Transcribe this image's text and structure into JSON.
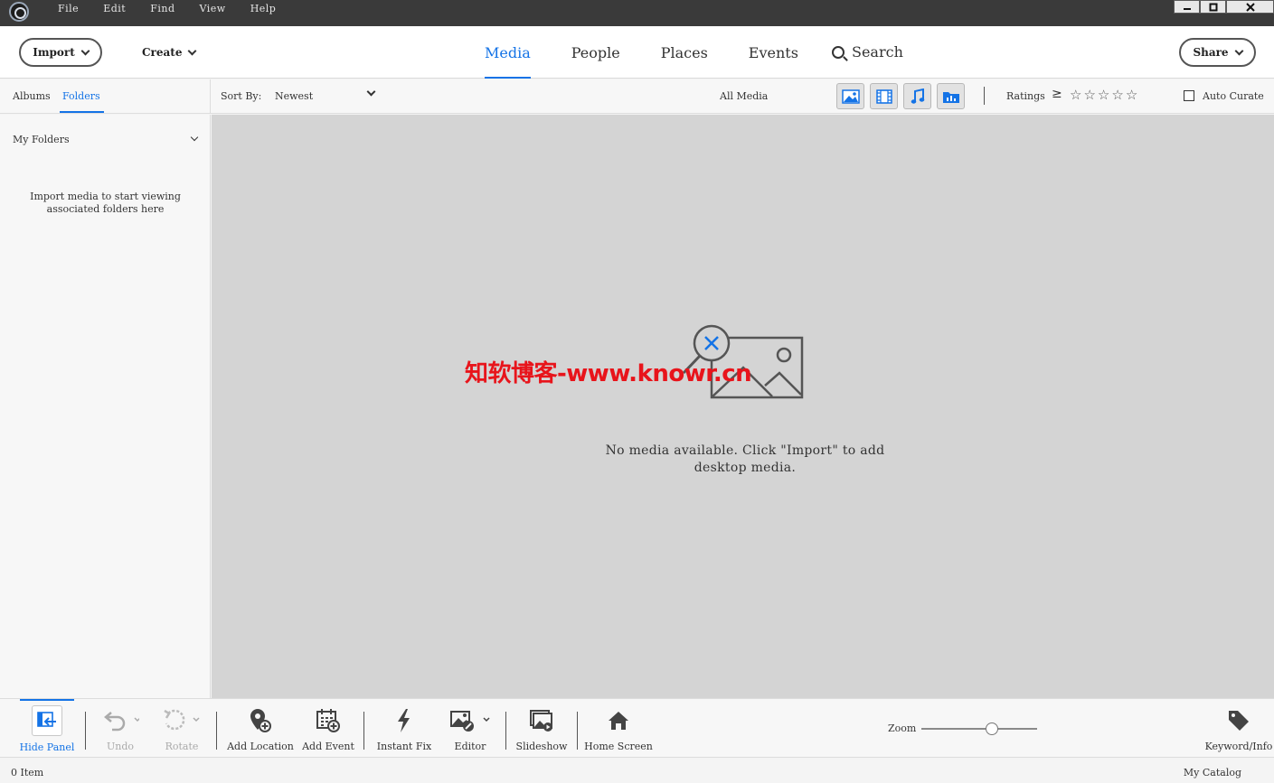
{
  "menu": [
    "File",
    "Edit",
    "Find",
    "View",
    "Help"
  ],
  "toolbar": {
    "import_label": "Import",
    "create_label": "Create",
    "share_label": "Share",
    "tabs": [
      {
        "label": "Media",
        "active": true
      },
      {
        "label": "People",
        "active": false
      },
      {
        "label": "Places",
        "active": false
      },
      {
        "label": "Events",
        "active": false
      }
    ],
    "search_label": "Search"
  },
  "subbar": {
    "side_tabs": [
      "Albums",
      "Folders"
    ],
    "active_side_tab": "Folders",
    "sort_label": "Sort By:",
    "sort_value": "Newest",
    "filter_label": "All Media",
    "media_types": [
      "photo-icon",
      "video-icon",
      "audio-icon",
      "project-icon"
    ],
    "ratings_label": "Ratings",
    "ratings_operator": "≥",
    "ratings_value": 0,
    "ratings_max": 5,
    "auto_curate_label": "Auto Curate",
    "auto_curate_checked": false
  },
  "left_panel": {
    "title": "My Folders",
    "hint_line1": "Import media to start viewing",
    "hint_line2": "associated folders here"
  },
  "grid": {
    "empty_line1": "No media available. Click \"Import\" to add",
    "empty_line2": "desktop media.",
    "watermark": "知软博客-www.knowr.cn"
  },
  "taskbar": {
    "hide_panel": "Hide Panel",
    "undo": "Undo",
    "rotate": "Rotate",
    "add_location": "Add Location",
    "add_event": "Add Event",
    "instant_fix": "Instant Fix",
    "editor": "Editor",
    "slideshow": "Slideshow",
    "home_screen": "Home Screen",
    "zoom_label": "Zoom",
    "zoom_level": 0.55,
    "keyword_info": "Keyword/Info"
  },
  "status": {
    "item_count": "0 Item",
    "catalog": "My Catalog"
  },
  "colors": {
    "accent": "#1473e6",
    "watermark": "#e8141b",
    "grid_bg": "#d4d4d4",
    "titlebar": "#3a3a3a"
  }
}
